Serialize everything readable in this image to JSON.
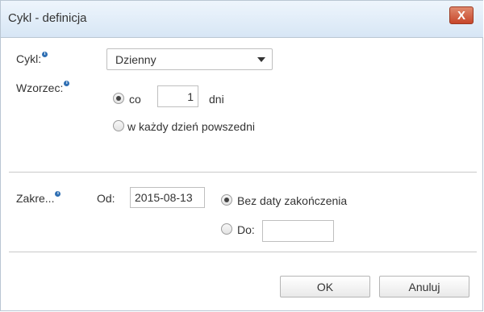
{
  "dialog": {
    "title": "Cykl - definicja",
    "close_label": "X"
  },
  "cycle": {
    "label": "Cykl:",
    "selected": "Dzienny"
  },
  "pattern": {
    "label": "Wzorzec:",
    "option_every": {
      "label": "co",
      "checked": true,
      "value": "1",
      "unit": "dni"
    },
    "option_weekday": {
      "label": "w każdy dzień powszedni",
      "checked": false
    }
  },
  "range": {
    "label": "Zakre...",
    "from_label": "Od:",
    "from_value": "2015-08-13",
    "no_end": {
      "label": "Bez daty zakończenia",
      "checked": true
    },
    "until": {
      "label": "Do:",
      "checked": false,
      "value": ""
    }
  },
  "buttons": {
    "ok": "OK",
    "cancel": "Anuluj"
  },
  "icons": {
    "info": "i"
  },
  "colors": {
    "close_button": "#c7462a",
    "title_bar": "#dce9f6",
    "info_icon": "#2f6fb3"
  }
}
